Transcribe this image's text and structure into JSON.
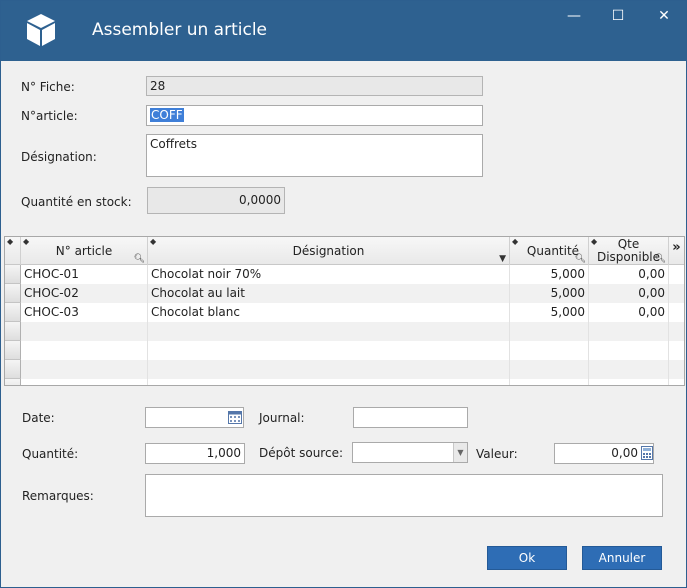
{
  "window": {
    "title": "Assembler un article",
    "minimize_glyph": "—",
    "maximize_glyph": "☐",
    "close_glyph": "✕"
  },
  "form": {
    "fiche_label": "N° Fiche:",
    "fiche_value": "28",
    "article_label": "N°article:",
    "article_value": "COFF",
    "designation_label": "Désignation:",
    "designation_value": "Coffrets",
    "stock_label": "Quantité en stock:",
    "stock_value": "0,0000"
  },
  "grid": {
    "columns": [
      "N° article",
      "Désignation",
      "Quantité",
      "Qte Disponible"
    ],
    "rows": [
      {
        "article": "CHOC-01",
        "designation": "Chocolat noir 70%",
        "quantite": "5,000",
        "dispo": "0,00"
      },
      {
        "article": "CHOC-02",
        "designation": "Chocolat au lait",
        "quantite": "5,000",
        "dispo": "0,00"
      },
      {
        "article": "CHOC-03",
        "designation": "Chocolat blanc",
        "quantite": "5,000",
        "dispo": "0,00"
      }
    ],
    "expand_glyph": "»"
  },
  "bottom": {
    "date_label": "Date:",
    "date_value": "",
    "journal_label": "Journal:",
    "journal_value": "",
    "quantite_label": "Quantité:",
    "quantite_value": "1,000",
    "depot_label": "Dépôt source:",
    "depot_value": "",
    "valeur_label": "Valeur:",
    "valeur_value": "0,00",
    "remarques_label": "Remarques:",
    "remarques_value": ""
  },
  "buttons": {
    "ok": "Ok",
    "cancel": "Annuler"
  },
  "colors": {
    "titlebar": "#2e6190",
    "button": "#2e6db5",
    "selection": "#3f7fd8"
  }
}
